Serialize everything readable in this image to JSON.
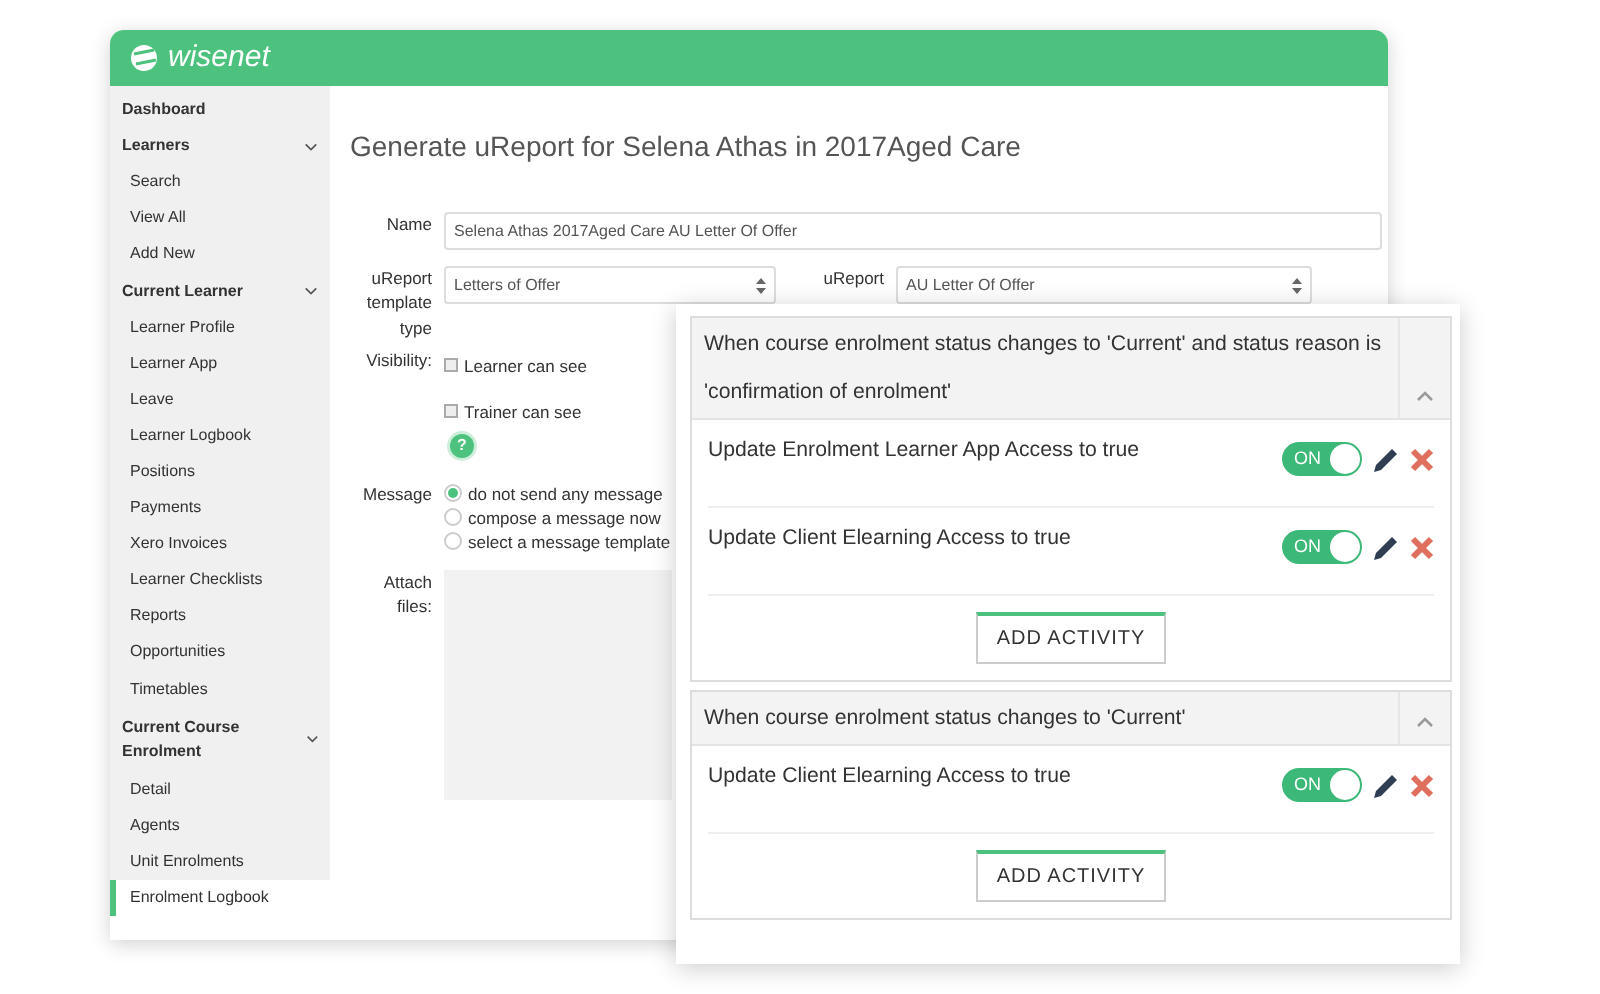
{
  "app": {
    "logo": "wisenet"
  },
  "sidebar": {
    "items": [
      {
        "label": "Dashboard",
        "kind": "heading",
        "selected": false
      },
      {
        "label": "Learners",
        "kind": "section",
        "expanded": true,
        "selected": false
      },
      {
        "label": "Search",
        "kind": "link",
        "selected": false
      },
      {
        "label": "View All",
        "kind": "link",
        "selected": false
      },
      {
        "label": "Add New",
        "kind": "link",
        "selected": false
      },
      {
        "label": "Current Learner",
        "kind": "section",
        "expanded": true,
        "selected": false
      },
      {
        "label": "Learner Profile",
        "kind": "link",
        "selected": false
      },
      {
        "label": "Learner App",
        "kind": "link",
        "selected": false
      },
      {
        "label": "Leave",
        "kind": "link",
        "selected": false
      },
      {
        "label": "Learner Logbook",
        "kind": "link",
        "selected": false
      },
      {
        "label": "Positions",
        "kind": "link",
        "selected": false
      },
      {
        "label": "Payments",
        "kind": "link",
        "selected": false
      },
      {
        "label": "Xero Invoices",
        "kind": "link",
        "selected": false
      },
      {
        "label": "Learner Checklists",
        "kind": "link",
        "selected": false
      },
      {
        "label": "Reports",
        "kind": "link",
        "selected": false
      },
      {
        "label": "Opportunities",
        "kind": "link",
        "selected": false
      },
      {
        "label": "Timetables",
        "kind": "link",
        "selected": false
      },
      {
        "label": "Current Course Enrolment",
        "kind": "section",
        "expanded": true,
        "selected": false
      },
      {
        "label": "Detail",
        "kind": "link",
        "selected": false
      },
      {
        "label": "Agents",
        "kind": "link",
        "selected": false
      },
      {
        "label": "Unit Enrolments",
        "kind": "link",
        "selected": false
      },
      {
        "label": "Enrolment Logbook",
        "kind": "link",
        "selected": true
      }
    ]
  },
  "form": {
    "title": "Generate uReport for Selena Athas in 2017Aged Care",
    "name": {
      "label": "Name",
      "value": "Selena Athas 2017Aged Care AU Letter Of Offer"
    },
    "template_type": {
      "label": "uReport template type",
      "value": "Letters of Offer"
    },
    "template": {
      "label": "uReport",
      "value": "AU Letter Of Offer"
    },
    "visibility": {
      "label": "Visibility:",
      "options": [
        {
          "label": "Learner can see",
          "checked": false
        },
        {
          "label": "Trainer can see",
          "checked": false
        }
      ],
      "help": "?"
    },
    "message": {
      "label": "Message",
      "options": [
        {
          "label": "do not send any message",
          "selected": true
        },
        {
          "label": "compose a message now",
          "selected": false
        },
        {
          "label": "select a message template",
          "selected": false
        }
      ]
    },
    "attach": {
      "label": "Attach files:"
    }
  },
  "workflow": {
    "groups": [
      {
        "condition": "When course enrolment status changes to 'Current' and status reason is 'confirmation of enrolment'",
        "expanded": true,
        "button": "ADD ACTIVITY",
        "activities": [
          {
            "text": "Update Enrolment Learner App Access to true",
            "on": true,
            "toggle_label": "ON"
          },
          {
            "text": "Update Client Elearning Access to true",
            "on": true,
            "toggle_label": "ON"
          }
        ]
      },
      {
        "condition": "When course enrolment status changes to 'Current'",
        "expanded": true,
        "button": "ADD ACTIVITY",
        "activities": [
          {
            "text": "Update Client Elearning Access to true",
            "on": true,
            "toggle_label": "ON"
          }
        ]
      }
    ]
  }
}
